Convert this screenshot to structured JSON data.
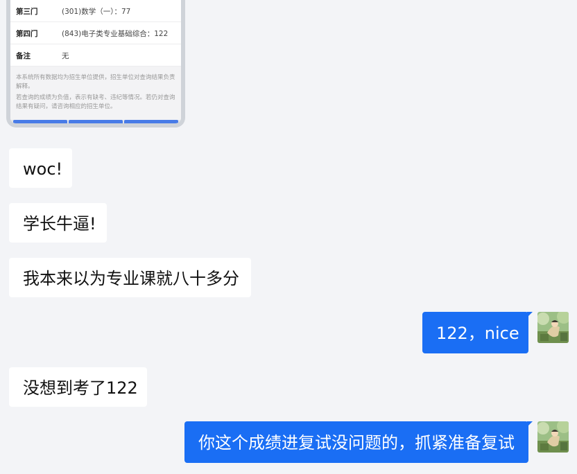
{
  "screenshot_card": {
    "rows": [
      {
        "key": "第三门",
        "value": "(301)数学（一）：77"
      },
      {
        "key": "第四门",
        "value": "(843)电子类专业基础综合：122"
      },
      {
        "key": "备注",
        "value": "无"
      }
    ],
    "notes": [
      "本系统所有数据均为招生单位提供，招生单位对查询结果负责解释。",
      "若查询的成绩为负值，表示有缺考、违纪等情况。若仍对查询结果有疑问，请咨询相应的招生单位。"
    ]
  },
  "messages": [
    {
      "side": "incoming",
      "text": "woc!"
    },
    {
      "side": "incoming",
      "text": "学长牛逼!"
    },
    {
      "side": "incoming",
      "text": "我本来以为专业课就八十多分"
    },
    {
      "side": "outgoing",
      "text": "122，nice",
      "avatar": "user-avatar"
    },
    {
      "side": "incoming",
      "text": "没想到考了122"
    },
    {
      "side": "outgoing",
      "text": "你这个成绩进复试没问题的，抓紧准备复试",
      "avatar": "user-avatar"
    }
  ],
  "colors": {
    "background": "#f3f4f7",
    "incoming_bubble": "#ffffff",
    "outgoing_bubble": "#1a6ef4"
  }
}
